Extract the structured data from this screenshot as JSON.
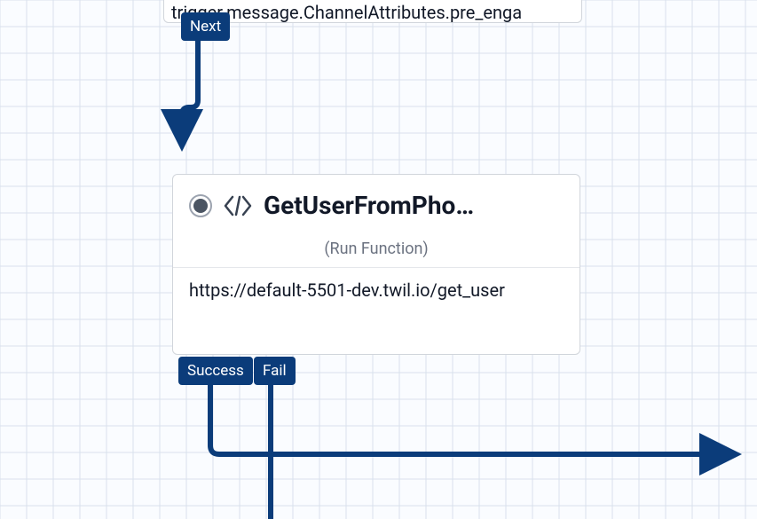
{
  "colors": {
    "accent": "#0b3c7a"
  },
  "top_widget": {
    "body_snippet": "trigger.message.ChannelAttributes.pre_enga",
    "port_next": "Next"
  },
  "main_widget": {
    "title": "GetUserFromPho…",
    "subtitle": "(Run Function)",
    "detail": "https://default-5501-dev.twil.io/get_user",
    "port_success": "Success",
    "port_fail": "Fail"
  }
}
